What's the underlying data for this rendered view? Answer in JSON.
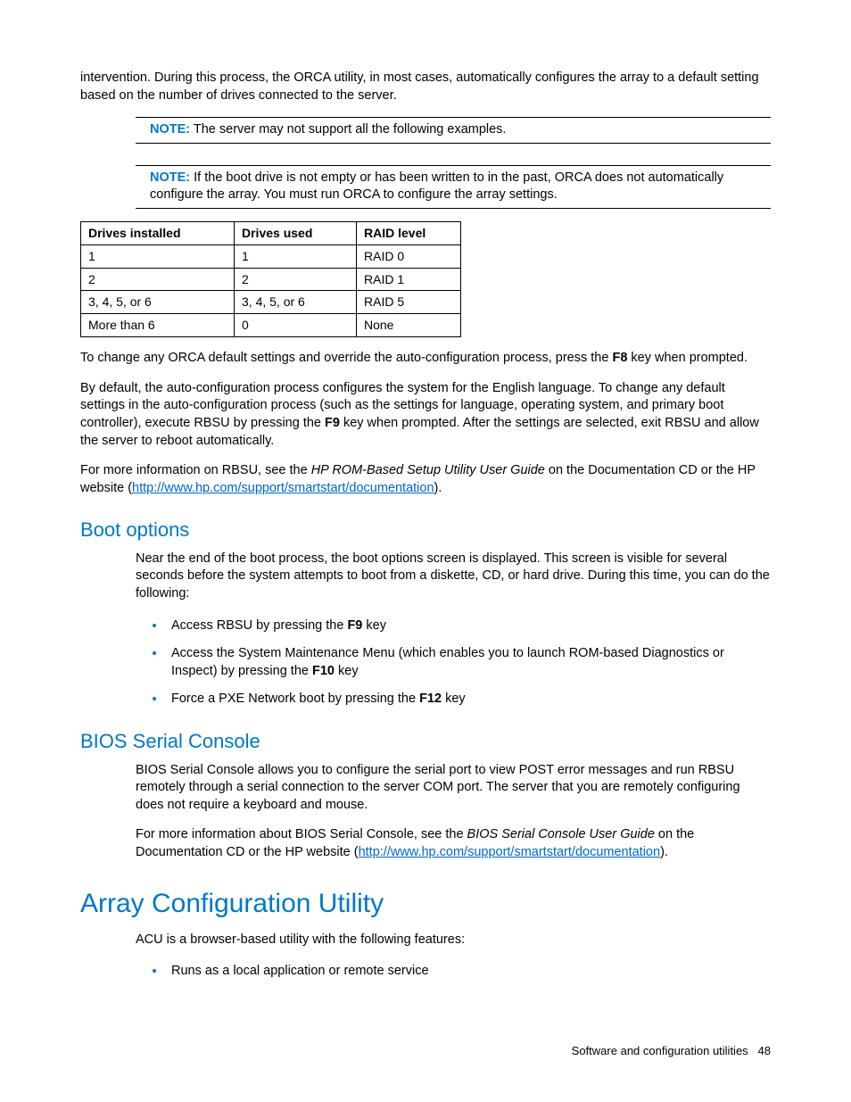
{
  "intro_para": "intervention. During this process, the ORCA utility, in most cases, automatically configures the array to a default setting based on the number of drives connected to the server.",
  "note1": {
    "label": "NOTE:",
    "text": "  The server may not support all the following examples."
  },
  "note2": {
    "label": "NOTE:",
    "text": "  If the boot drive is not empty or has been written to in the past, ORCA does not automatically configure the array. You must run ORCA to configure the array settings."
  },
  "table": {
    "headers": [
      "Drives installed",
      "Drives used",
      "RAID level"
    ],
    "rows": [
      [
        "1",
        "1",
        "RAID 0"
      ],
      [
        "2",
        "2",
        "RAID 1"
      ],
      [
        "3, 4, 5, or 6",
        "3, 4, 5, or 6",
        "RAID 5"
      ],
      [
        "More than 6",
        "0",
        "None"
      ]
    ]
  },
  "para_f8_a": "To change any ORCA default settings and override the auto-configuration process, press the ",
  "para_f8_key": "F8",
  "para_f8_b": " key when prompted.",
  "para_f9_a": "By default, the auto-configuration process configures the system for the English language. To change any default settings in the auto-configuration process (such as the settings for language, operating system, and primary boot controller), execute RBSU by pressing the ",
  "para_f9_key": "F9",
  "para_f9_b": " key when prompted. After the settings are selected, exit RBSU and allow the server to reboot automatically.",
  "para_rbsu_a": "For more information on RBSU, see the ",
  "para_rbsu_italic": "HP ROM-Based Setup Utility User Guide",
  "para_rbsu_b": " on the Documentation CD or the HP website (",
  "para_rbsu_link": "http://www.hp.com/support/smartstart/documentation",
  "para_rbsu_c": ").",
  "boot_heading": "Boot options",
  "boot_para": "Near the end of the boot process, the boot options screen is displayed. This screen is visible for several seconds before the system attempts to boot from a diskette, CD, or hard drive. During this time, you can do the following:",
  "boot_li1_a": "Access RBSU by pressing the ",
  "boot_li1_key": "F9",
  "boot_li1_b": " key",
  "boot_li2_a": "Access the System Maintenance Menu (which enables you to launch ROM-based Diagnostics or Inspect) by pressing the ",
  "boot_li2_key": "F10",
  "boot_li2_b": " key",
  "boot_li3_a": "Force a PXE Network boot by pressing the ",
  "boot_li3_key": "F12",
  "boot_li3_b": " key",
  "bios_heading": "BIOS Serial Console",
  "bios_para1": "BIOS Serial Console allows you to configure the serial port to view POST error messages and run RBSU remotely through a serial connection to the server COM port. The server that you are remotely configuring does not require a keyboard and mouse.",
  "bios_para2_a": "For more information about BIOS Serial Console, see the ",
  "bios_para2_italic": "BIOS Serial Console User Guide",
  "bios_para2_b": " on the Documentation CD or the HP website (",
  "bios_para2_link": "http://www.hp.com/support/smartstart/documentation",
  "bios_para2_c": ").",
  "acu_heading": "Array Configuration Utility",
  "acu_para": "ACU is a browser-based utility with the following features:",
  "acu_li1": "Runs as a local application or remote service",
  "footer_text": "Software and configuration utilities",
  "footer_page": "48"
}
